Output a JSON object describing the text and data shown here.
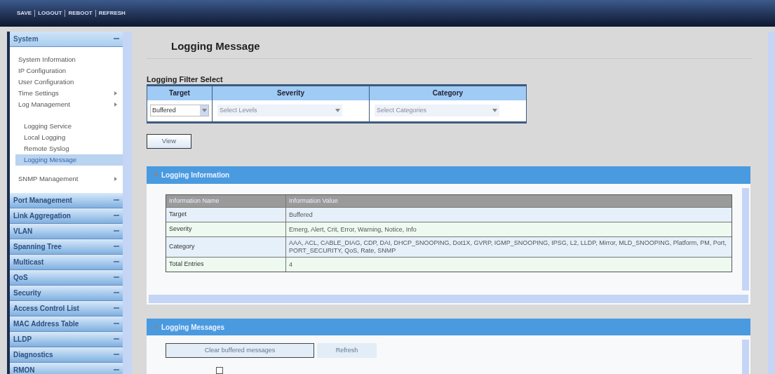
{
  "toolbar": {
    "links": [
      "SAVE",
      "LOGOUT",
      "REBOOT",
      "REFRESH"
    ]
  },
  "sidebar": {
    "sections": [
      {
        "label": "System",
        "expanded": true,
        "children": [
          {
            "label": "System Information",
            "has_submenu": false,
            "selected": false
          },
          {
            "label": "IP Configuration",
            "has_submenu": false,
            "selected": false
          },
          {
            "label": "User Configuration",
            "has_submenu": false,
            "selected": false
          },
          {
            "label": "Time Settings",
            "has_submenu": true,
            "selected": false
          },
          {
            "label": "Log Management",
            "has_submenu": true,
            "selected": false,
            "children": [
              {
                "label": "Logging Service",
                "selected": false
              },
              {
                "label": "Local Logging",
                "selected": false
              },
              {
                "label": "Remote Syslog",
                "selected": false
              },
              {
                "label": "Logging Message",
                "selected": true
              }
            ]
          },
          {
            "label": "SNMP Management",
            "has_submenu": true,
            "selected": false
          }
        ]
      },
      {
        "label": "Port Management",
        "expanded": false
      },
      {
        "label": "Link Aggregation",
        "expanded": false
      },
      {
        "label": "VLAN",
        "expanded": false
      },
      {
        "label": "Spanning Tree",
        "expanded": false
      },
      {
        "label": "Multicast",
        "expanded": false
      },
      {
        "label": "QoS",
        "expanded": false
      },
      {
        "label": "Security",
        "expanded": false
      },
      {
        "label": "Access Control List",
        "expanded": false
      },
      {
        "label": "MAC Address Table",
        "expanded": false
      },
      {
        "label": "LLDP",
        "expanded": false
      },
      {
        "label": "Diagnostics",
        "expanded": false
      },
      {
        "label": "RMON",
        "expanded": false
      }
    ]
  },
  "page": {
    "title": "Logging Message",
    "filter": {
      "title": "Logging Filter Select",
      "columns": [
        "Target",
        "Severity",
        "Category"
      ],
      "target": {
        "value": "Buffered"
      },
      "severity": {
        "placeholder": "Select Levels"
      },
      "category": {
        "placeholder": "Select Categories"
      },
      "view_button": "View"
    },
    "info_panel": {
      "title": "Logging Information",
      "columns": [
        "Information Name",
        "Information Value"
      ],
      "rows": [
        {
          "name": "Target",
          "value": "Buffered"
        },
        {
          "name": "Severity",
          "value": "Emerg, Alert, Crit, Error, Warning, Notice, Info"
        },
        {
          "name": "Category",
          "value": "AAA, ACL, CABLE_DIAG, CDP, DAI, DHCP_SNOOPING, Dot1X, GVRP, IGMP_SNOOPING, IPSG, L2, LLDP, Mirror, MLD_SNOOPING, Platform, PM, Port, PORT_SECURITY, QoS, Rate, SNMP"
        },
        {
          "name": "Total Entries",
          "value": "4"
        }
      ]
    },
    "messages_panel": {
      "title": "Logging Messages",
      "buttons": [
        "Clear buffered messages",
        "Refresh"
      ],
      "checkbox": {
        "checked": false
      }
    }
  }
}
